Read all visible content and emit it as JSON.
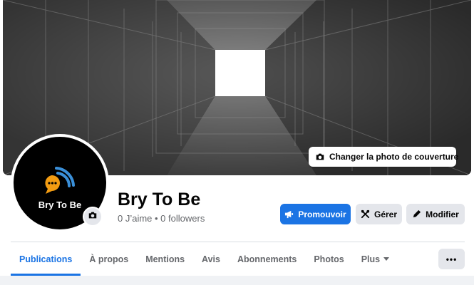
{
  "cover": {
    "change_cover_label": "Changer la photo de couverture",
    "camera_icon": "camera-icon"
  },
  "profile": {
    "logo_text": "Bry To Be",
    "name": "Bry To Be",
    "stats": "0 J’aime • 0 followers",
    "avatar_camera_icon": "camera-icon"
  },
  "actions": {
    "promote_label": "Promouvoir",
    "promote_icon": "megaphone-icon",
    "manage_label": "Gérer",
    "manage_icon": "tools-icon",
    "edit_label": "Modifier",
    "edit_icon": "pencil-icon",
    "more_label": "•••"
  },
  "tabs": [
    {
      "label": "Publications",
      "active": true
    },
    {
      "label": "À propos"
    },
    {
      "label": "Mentions"
    },
    {
      "label": "Avis"
    },
    {
      "label": "Abonnements"
    },
    {
      "label": "Photos"
    },
    {
      "label": "Plus",
      "caret": true
    }
  ],
  "colors": {
    "accent": "#1b74e4",
    "button_grey": "#e4e6eb",
    "logo_orange": "#f39c12",
    "logo_blue": "#3a8fd8"
  }
}
